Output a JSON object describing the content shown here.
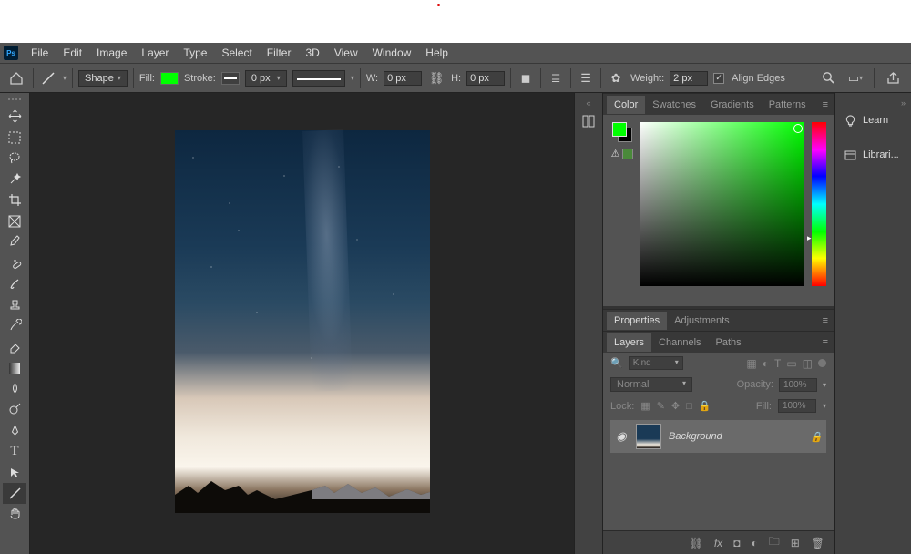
{
  "menu": {
    "file": "File",
    "edit": "Edit",
    "image": "Image",
    "layer": "Layer",
    "type": "Type",
    "select": "Select",
    "filter": "Filter",
    "threeD": "3D",
    "view": "View",
    "window": "Window",
    "help": "Help"
  },
  "options": {
    "mode": "Shape",
    "fill_label": "Fill:",
    "fill_color": "#00ff00",
    "stroke_label": "Stroke:",
    "stroke_width": "0 px",
    "w_label": "W:",
    "w_value": "0 px",
    "h_label": "H:",
    "h_value": "0 px",
    "weight_label": "Weight:",
    "weight_value": "2 px",
    "align_label": "Align Edges",
    "align_checked": "✓"
  },
  "color_panel": {
    "tabs": {
      "color": "Color",
      "swatches": "Swatches",
      "gradients": "Gradients",
      "patterns": "Patterns"
    }
  },
  "properties_tabs": {
    "properties": "Properties",
    "adjustments": "Adjustments"
  },
  "layers_tabs": {
    "layers": "Layers",
    "channels": "Channels",
    "paths": "Paths"
  },
  "layers": {
    "kind": "Kind",
    "blend": "Normal",
    "opacity_label": "Opacity:",
    "opacity": "100%",
    "lock_label": "Lock:",
    "fill_label": "Fill:",
    "fill": "100%",
    "items": [
      {
        "name": "Background"
      }
    ]
  },
  "rightdock": {
    "learn": "Learn",
    "libraries": "Librari..."
  }
}
